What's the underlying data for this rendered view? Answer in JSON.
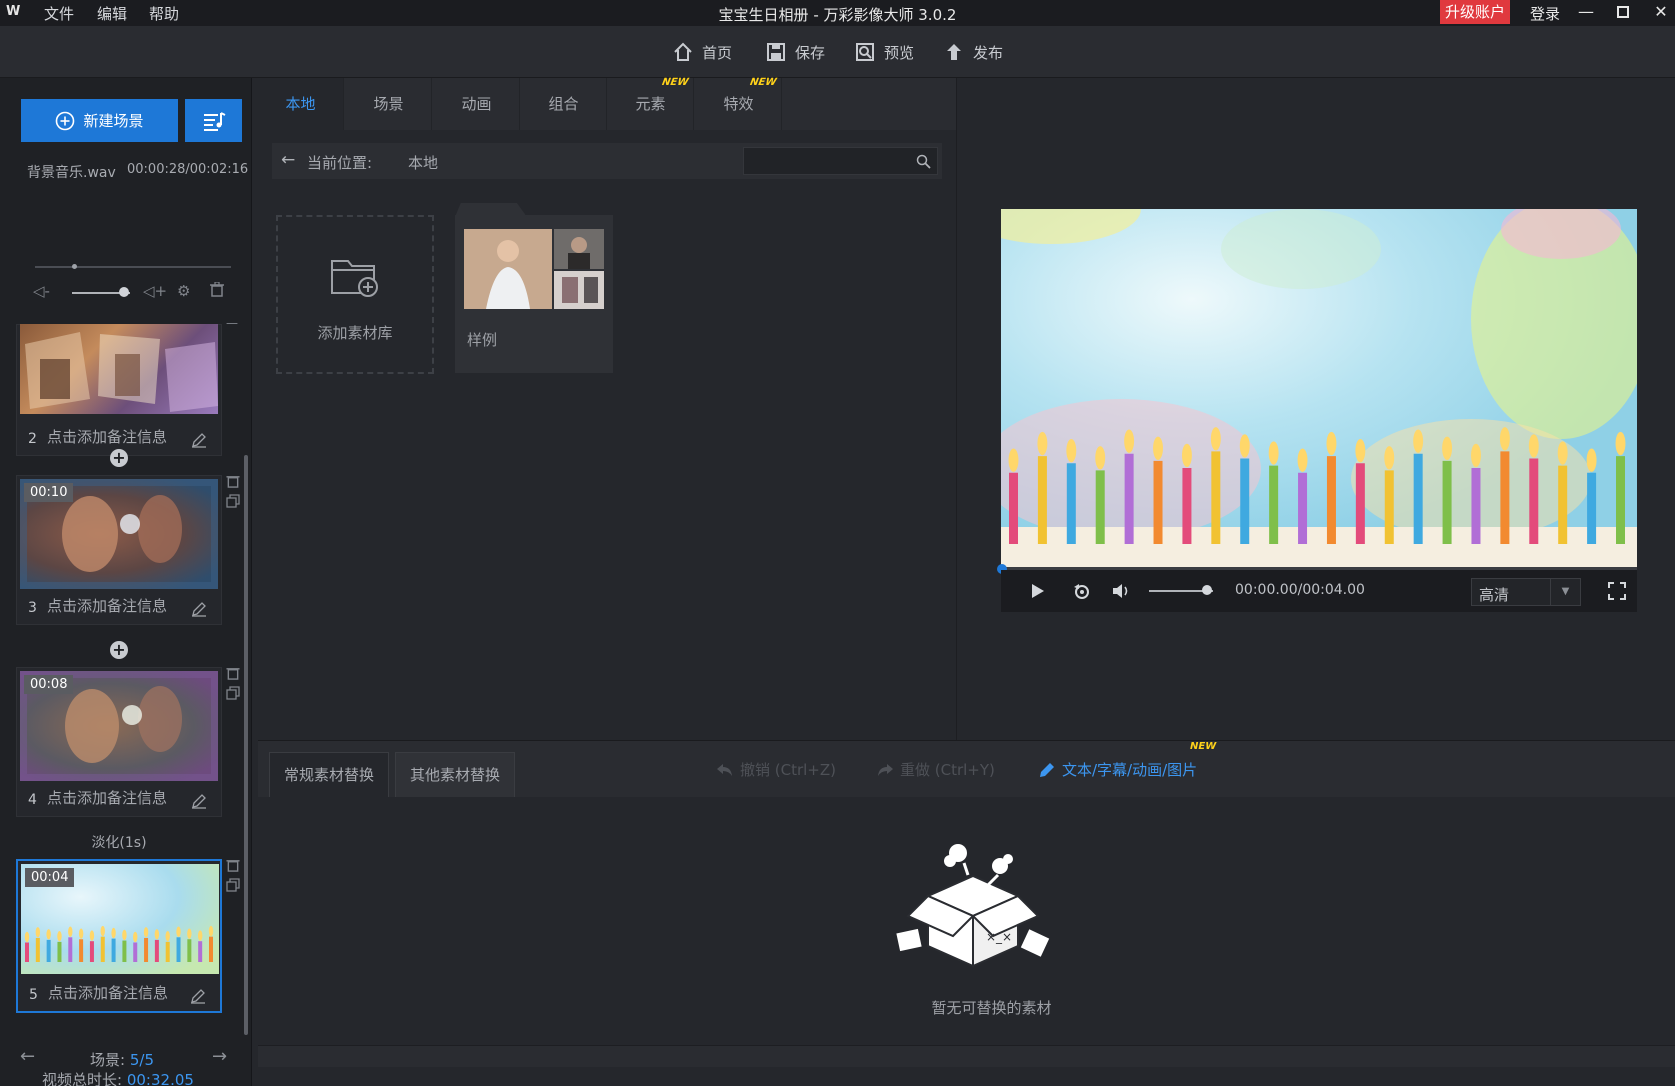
{
  "titlebar": {
    "logo": "W",
    "menu": [
      "文件",
      "编辑",
      "帮助"
    ],
    "title": "宝宝生日相册 - 万彩影像大师 3.0.2",
    "upgrade": "升级账户",
    "login": "登录"
  },
  "toolbar": {
    "home": "首页",
    "save": "保存",
    "preview": "预览",
    "publish": "发布"
  },
  "left": {
    "new_scene": "新建场景",
    "music_name": "背景音乐.wav",
    "music_time": "00:00:28/00:02:16",
    "music_progress": 0.2,
    "music_volume": 0.9,
    "scenes": [
      {
        "num": "2",
        "duration": "",
        "note": "点击添加备注信息"
      },
      {
        "num": "3",
        "duration": "00:10",
        "note": "点击添加备注信息"
      },
      {
        "num": "4",
        "duration": "00:08",
        "note": "点击添加备注信息"
      },
      {
        "num": "5",
        "duration": "00:04",
        "note": "点击添加备注信息"
      }
    ],
    "transition": "淡化(1s)",
    "scene_label": "场景:",
    "scene_current": "5/5",
    "total_label": "视频总时长:",
    "total_value": "00:32.05"
  },
  "library": {
    "tabs": [
      "本地",
      "场景",
      "动画",
      "组合",
      "元素",
      "特效"
    ],
    "new_badge": "NEW",
    "location_label": "当前位置:",
    "location_value": "本地",
    "search_placeholder": "",
    "add_library": "添加素材库",
    "sample": "样例"
  },
  "player": {
    "time": "00:00.00/00:04.00",
    "quality": "高清",
    "progress": 0,
    "volume": 0.9
  },
  "bottom": {
    "tab_regular": "常规素材替换",
    "tab_other": "其他素材替换",
    "undo": "撤销 (Ctrl+Z)",
    "redo": "重做 (Ctrl+Y)",
    "text_link": "文本/字幕/动画/图片",
    "new_badge": "NEW",
    "empty": "暂无可替换的素材"
  },
  "colors": {
    "accent": "#1e78d7",
    "highlight": "#3c96f0",
    "upgrade": "#e0393e",
    "badge": "#ffd21a"
  }
}
